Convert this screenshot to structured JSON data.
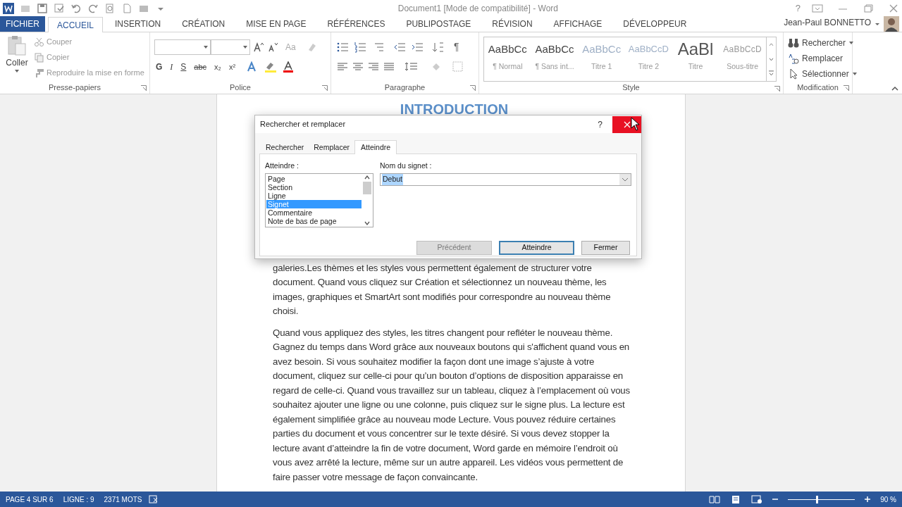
{
  "title_bar": {
    "title": "Document1 [Mode de compatibilité] - Word",
    "help": "?"
  },
  "ribbon_tabs": [
    {
      "label": "FICHIER",
      "kind": "file",
      "selected": false
    },
    {
      "label": "ACCUEIL",
      "kind": "tab",
      "selected": true
    },
    {
      "label": "INSERTION",
      "kind": "tab",
      "selected": false
    },
    {
      "label": "CRÉATION",
      "kind": "tab",
      "selected": false
    },
    {
      "label": "MISE EN PAGE",
      "kind": "tab",
      "selected": false
    },
    {
      "label": "RÉFÉRENCES",
      "kind": "tab",
      "selected": false
    },
    {
      "label": "PUBLIPOSTAGE",
      "kind": "tab",
      "selected": false
    },
    {
      "label": "RÉVISION",
      "kind": "tab",
      "selected": false
    },
    {
      "label": "AFFICHAGE",
      "kind": "tab",
      "selected": false
    },
    {
      "label": "DÉVELOPPEUR",
      "kind": "tab",
      "selected": false
    }
  ],
  "user": "Jean-Paul BONNETTO",
  "clipboard": {
    "paste": "Coller",
    "items": [
      "Couper",
      "Copier",
      "Reproduire la mise en forme"
    ],
    "label": "Presse-papiers"
  },
  "font_group": {
    "case_button": "Aa",
    "format_buttons": [
      "G",
      "I",
      "S",
      "abc",
      "x₂",
      "x²"
    ],
    "label": "Police"
  },
  "paragraph_group": {
    "show_marks": "¶",
    "label": "Paragraphe"
  },
  "styles": [
    {
      "preview": "AaBbCc",
      "name": "¶ Normal",
      "kind": "normal"
    },
    {
      "preview": "AaBbCc",
      "name": "¶ Sans int...",
      "kind": "normal"
    },
    {
      "preview": "AaBbCc",
      "name": "Titre 1",
      "kind": "heading1"
    },
    {
      "preview": "AaBbCcD",
      "name": "Titre 2",
      "kind": "heading2"
    },
    {
      "preview": "AaBl",
      "name": "Titre",
      "kind": "title"
    },
    {
      "preview": "AaBbCcD",
      "name": "Sous-titre",
      "kind": "subtitle"
    }
  ],
  "style_group_label": "Style",
  "editing": {
    "items": [
      "Rechercher",
      "Remplacer",
      "Sélectionner"
    ],
    "label": "Modification"
  },
  "document": {
    "heading": "INTRODUCTION",
    "paragraphs": [
      "galeries.Les thèmes et les styles vous permettent également de structurer votre document. Quand vous cliquez sur Création et sélectionnez un nouveau thème, les images, graphiques et SmartArt sont modifiés pour correspondre au nouveau thème choisi.",
      "Quand vous appliquez des styles, les titres changent pour refléter le nouveau thème. Gagnez du temps dans Word grâce aux nouveaux boutons qui s'affichent quand vous en avez besoin. Si vous souhaitez modifier la façon dont une image s’ajuste à votre document, cliquez sur celle-ci pour qu’un bouton d’options de disposition apparaisse en regard de celle-ci. Quand vous travaillez sur un tableau, cliquez à l’emplacement où vous souhaitez ajouter une ligne ou une colonne, puis cliquez sur le signe plus. La lecture est également simplifiée grâce au nouveau mode Lecture. Vous pouvez réduire certaines parties du document et vous concentrer sur le texte désiré. Si vous devez stopper la lecture avant d’atteindre la fin de votre document, Word garde en mémoire l’endroit où vous avez arrêté la lecture, même sur un autre appareil. Les vidéos vous permettent de faire passer votre message de façon convaincante."
    ]
  },
  "dialog": {
    "title": "Rechercher et remplacer",
    "help": "?",
    "tabs": [
      {
        "label": "Rechercher",
        "selected": false
      },
      {
        "label": "Remplacer",
        "selected": false
      },
      {
        "label": "Atteindre",
        "selected": true
      }
    ],
    "goto_label": "Atteindre :",
    "goto_items": [
      {
        "label": "Page",
        "selected": false
      },
      {
        "label": "Section",
        "selected": false
      },
      {
        "label": "Ligne",
        "selected": false
      },
      {
        "label": "Signet",
        "selected": true
      },
      {
        "label": "Commentaire",
        "selected": false
      },
      {
        "label": "Note de bas de page",
        "selected": false
      }
    ],
    "name_label": "Nom du signet :",
    "name_value": "Debut",
    "buttons": [
      {
        "label": "Précédent",
        "disabled": true,
        "default": false
      },
      {
        "label": "Atteindre",
        "disabled": false,
        "default": true
      },
      {
        "label": "Fermer",
        "disabled": false,
        "default": false
      }
    ]
  },
  "status_bar": {
    "items": [
      "PAGE 4 SUR 6",
      "LIGNE : 9",
      "2371 MOTS"
    ],
    "zoom": "90 %",
    "level": 0.43
  }
}
